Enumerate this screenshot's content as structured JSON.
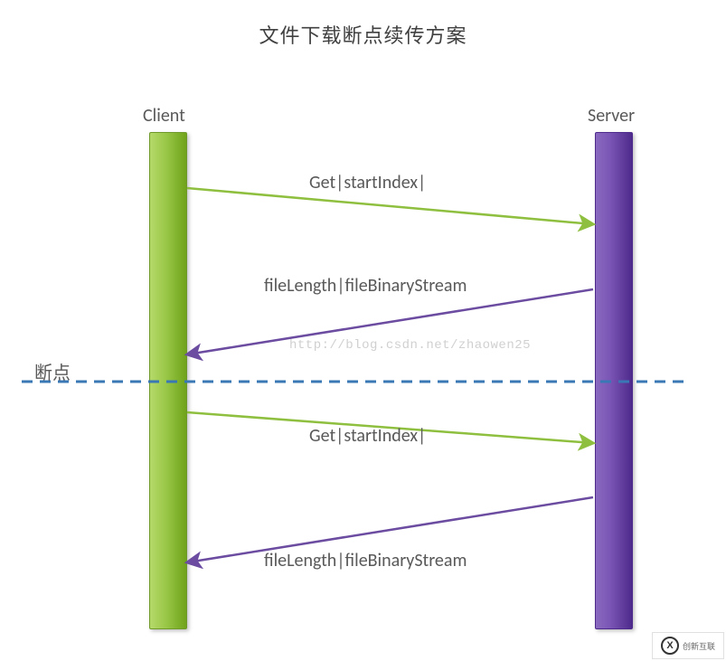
{
  "title": "文件下载断点续传方案",
  "actors": {
    "client": "Client",
    "server": "Server"
  },
  "messages": {
    "m1": "Get|startIndex|",
    "m2": "fileLength|fileBinaryStream",
    "m3": "Get|startIndex|",
    "m4": "fileLength|fileBinaryStream"
  },
  "breakpoint_label": "断点",
  "watermark": "http://blog.csdn.net/zhaowen25",
  "logo_text": "创新互联",
  "colors": {
    "client_green": "#8fbf3f",
    "server_purple": "#6b4ca0",
    "break_blue": "#3a78b5"
  },
  "chart_data": {
    "type": "sequence_diagram",
    "title": "文件下载断点续传方案",
    "actors": [
      "Client",
      "Server"
    ],
    "events": [
      {
        "from": "Client",
        "to": "Server",
        "label": "Get|startIndex|"
      },
      {
        "from": "Server",
        "to": "Client",
        "label": "fileLength|fileBinaryStream"
      },
      {
        "type": "divider",
        "label": "断点"
      },
      {
        "from": "Client",
        "to": "Server",
        "label": "Get|startIndex|"
      },
      {
        "from": "Server",
        "to": "Client",
        "label": "fileLength|fileBinaryStream"
      }
    ]
  }
}
